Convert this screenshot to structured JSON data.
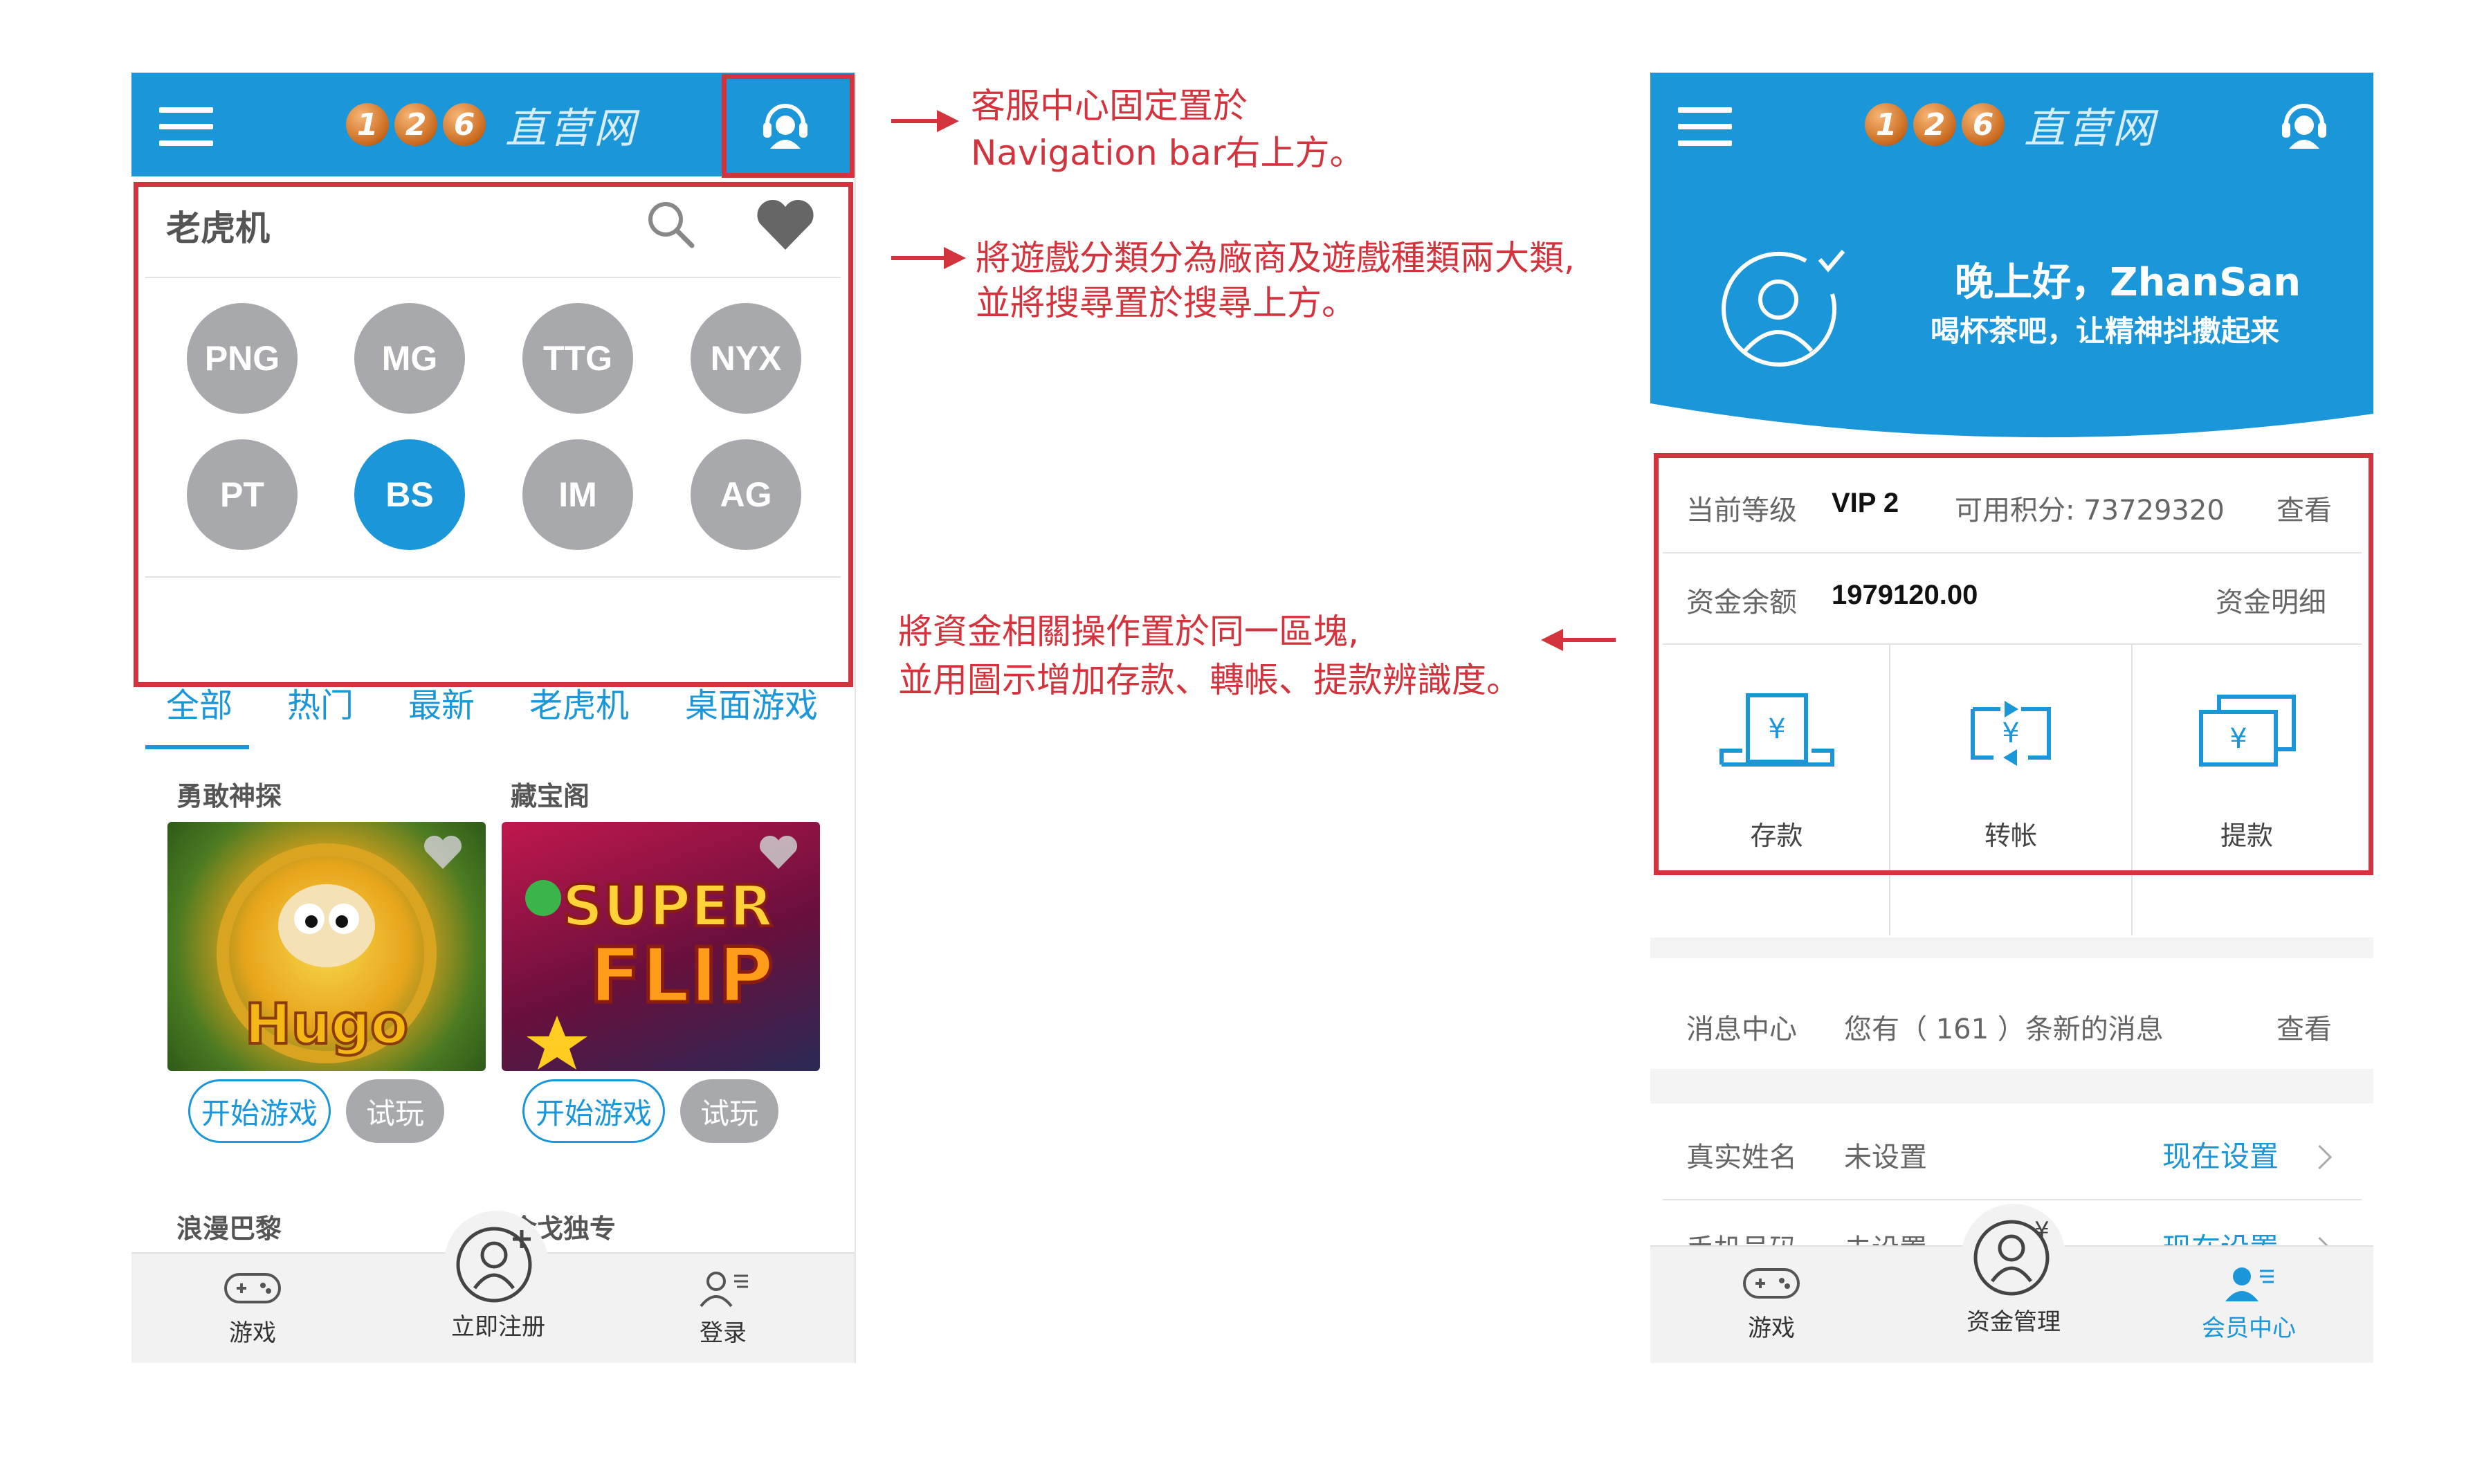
{
  "left_screen": {
    "logo": {
      "digits": [
        "1",
        "2",
        "6"
      ],
      "text": "直营网"
    },
    "search_bar": {
      "title": "老虎机"
    },
    "providers": [
      {
        "label": "PNG",
        "active": false
      },
      {
        "label": "MG",
        "active": false
      },
      {
        "label": "TTG",
        "active": false
      },
      {
        "label": "NYX",
        "active": false
      },
      {
        "label": "PT",
        "active": false
      },
      {
        "label": "BS",
        "active": true
      },
      {
        "label": "IM",
        "active": false
      },
      {
        "label": "AG",
        "active": false
      }
    ],
    "tabs": [
      "全部",
      "热门",
      "最新",
      "老虎机",
      "桌面游戏"
    ],
    "games": [
      {
        "title": "勇敢神探",
        "start": "开始游戏",
        "try": "试玩"
      },
      {
        "title": "藏宝阁",
        "start": "开始游戏",
        "try": "试玩"
      },
      {
        "title": "浪漫巴黎"
      },
      {
        "title": "金戈独专"
      }
    ],
    "bottom_nav": [
      {
        "label": "游戏",
        "icon": "gamepad-icon"
      },
      {
        "label": "立即注册",
        "icon": "user-add-icon"
      },
      {
        "label": "登录",
        "icon": "login-user-icon"
      }
    ]
  },
  "annotations": {
    "a1_line1": "客服中心固定置於",
    "a1_line2": "Navigation  bar右上方。",
    "a2_line1": "將遊戲分類分為廠商及遊戲種類兩大類,",
    "a2_line2": "並將搜尋置於搜尋上方。",
    "a3_line1": "將資金相關操作置於同一區塊,",
    "a3_line2": "並用圖示增加存款、轉帳、提款辨識度。"
  },
  "right_screen": {
    "logo": {
      "digits": [
        "1",
        "2",
        "6"
      ],
      "text": "直营网"
    },
    "greeting": "晚上好，ZhanSan",
    "sub_greeting": "喝杯茶吧，让精神抖擻起来",
    "level_label": "当前等级",
    "level_value": "VIP 2",
    "points_label": "可用积分: 73729320",
    "view_label": "查看",
    "balance_label": "资金余额",
    "balance_value": "1979120.00",
    "detail_label": "资金明细",
    "actions": [
      {
        "label": "存款",
        "icon": "deposit-icon"
      },
      {
        "label": "转帐",
        "icon": "transfer-icon"
      },
      {
        "label": "提款",
        "icon": "withdraw-icon"
      }
    ],
    "messages": {
      "label": "消息中心",
      "text": "您有（ 161 ）条新的消息",
      "action": "查看"
    },
    "realname": {
      "label": "真实姓名",
      "value": "未设置",
      "action": "现在设置"
    },
    "phone": {
      "label": "手机号码",
      "value": "未设置",
      "action": "现在设置"
    },
    "bottom_nav": [
      {
        "label": "游戏",
        "icon": "gamepad-icon"
      },
      {
        "label": "资金管理",
        "icon": "money-user-icon"
      },
      {
        "label": "会员中心",
        "icon": "member-icon"
      }
    ]
  }
}
